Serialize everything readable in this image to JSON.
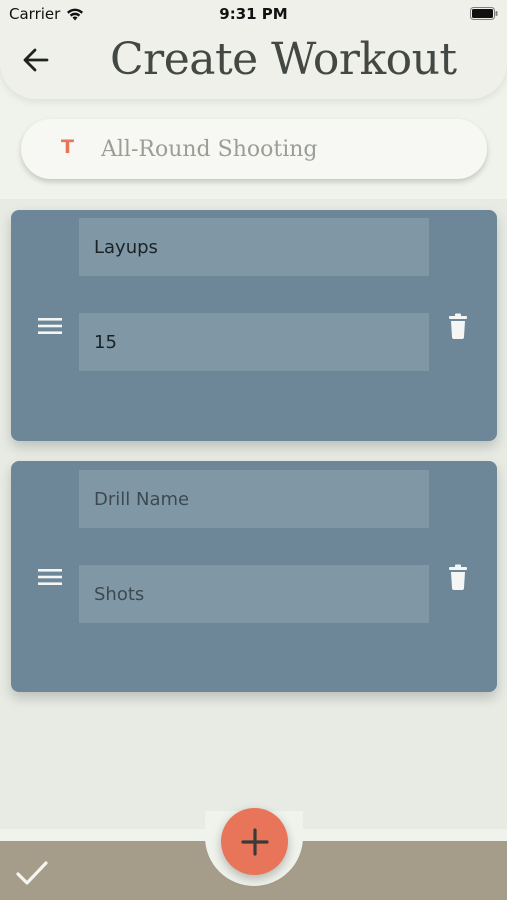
{
  "status_bar": {
    "carrier": "Carrier",
    "time": "9:31 PM"
  },
  "header": {
    "title": "Create Workout"
  },
  "workout": {
    "name": "All-Round Shooting",
    "name_icon": "T"
  },
  "drills": [
    {
      "name": "Layups",
      "name_placeholder": "Drill Name",
      "shots": "15",
      "shots_placeholder": "Shots"
    },
    {
      "name": "",
      "name_placeholder": "Drill Name",
      "shots": "",
      "shots_placeholder": "Shots"
    }
  ],
  "icons": {
    "back": "arrow-left-icon",
    "drag": "drag-handle-icon",
    "delete": "trash-icon",
    "add": "plus-icon",
    "confirm": "checkmark-icon"
  },
  "colors": {
    "accent": "#e8755a",
    "card": "#6d8799",
    "field": "#8098a6",
    "bottom_bar": "#a59c89",
    "title": "#434845"
  }
}
